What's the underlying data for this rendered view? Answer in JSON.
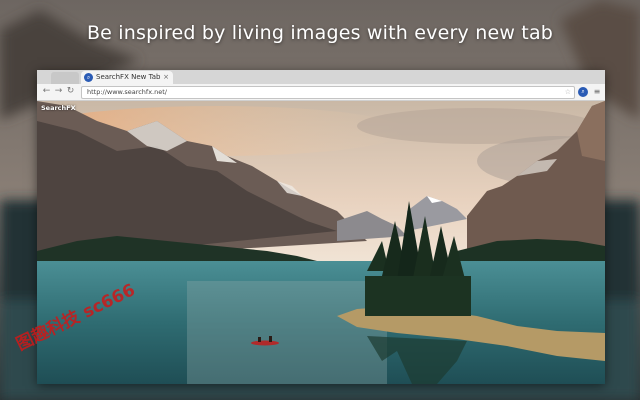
{
  "headline": "Be inspired by living images with every new tab",
  "browser": {
    "tab": {
      "title": "SearchFX New Tab",
      "icon": "searchfx-icon"
    },
    "address_bar": {
      "url": "http://www.searchfx.net/"
    }
  },
  "page": {
    "brand": "SearchFX"
  },
  "watermark": "图趣科技 sc666",
  "colors": {
    "accent": "#2a5bb5"
  }
}
